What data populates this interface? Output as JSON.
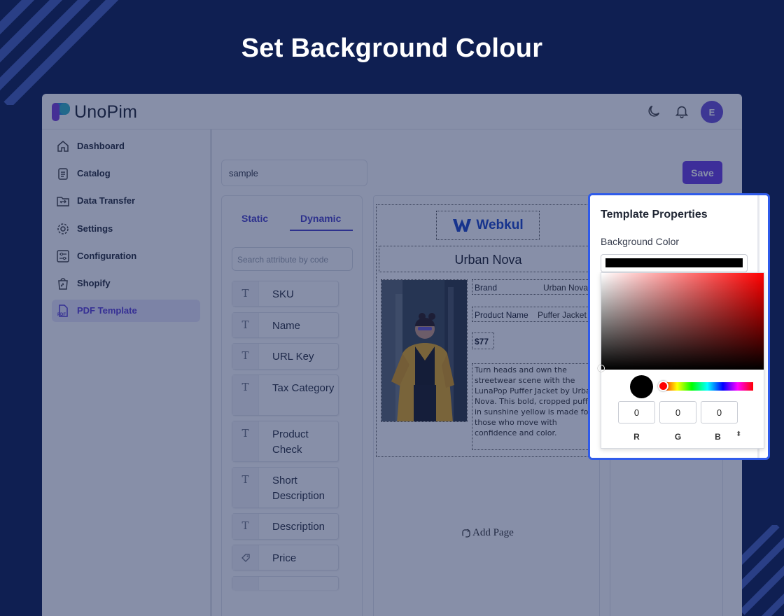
{
  "banner": {
    "title": "Set Background Colour"
  },
  "app": {
    "logo_text": "UnoPim",
    "user_initial": "E"
  },
  "sidebar": {
    "items": [
      {
        "label": "Dashboard",
        "icon": "home-icon"
      },
      {
        "label": "Catalog",
        "icon": "clipboard-icon"
      },
      {
        "label": "Data Transfer",
        "icon": "folder-transfer-icon"
      },
      {
        "label": "Settings",
        "icon": "gear-icon"
      },
      {
        "label": "Configuration",
        "icon": "sliders-icon"
      },
      {
        "label": "Shopify",
        "icon": "shopify-bag-icon"
      },
      {
        "label": "PDF Template",
        "icon": "pdf-icon",
        "active": true
      }
    ]
  },
  "editor": {
    "template_name": "sample",
    "save_label": "Save",
    "tabs": {
      "static": "Static",
      "dynamic": "Dynamic",
      "active": "Dynamic"
    },
    "attribute_search_placeholder": "Search attribute by code",
    "attributes": [
      {
        "label": "SKU",
        "icon": "T"
      },
      {
        "label": "Name",
        "icon": "T"
      },
      {
        "label": "URL Key",
        "icon": "T"
      },
      {
        "label": "Tax Category",
        "icon": "T"
      },
      {
        "label": "Product Check",
        "icon": "T"
      },
      {
        "label": "Short Description",
        "icon": "T"
      },
      {
        "label": "Description",
        "icon": "T"
      },
      {
        "label": "Price",
        "icon": "price-tag-icon"
      }
    ]
  },
  "canvas": {
    "logo_text": "Webkul",
    "brand_title": "Urban Nova",
    "fields": [
      {
        "key": "Brand",
        "value": "Urban Nova"
      },
      {
        "key": "Product Name",
        "value": "Puffer Jacket"
      }
    ],
    "price": "$77",
    "description": "Turn heads and own the streetwear scene with the LunaPop Puffer Jacket by Urban Nova. This bold, cropped puffer in sunshine yellow is made for those who move with confidence and color.",
    "add_page_label": "Add  Page"
  },
  "properties": {
    "title": "Template Properties",
    "background_label": "Background Color",
    "background_value": "#000000",
    "rgb": {
      "r": "0",
      "g": "0",
      "b": "0"
    },
    "rgb_labels": {
      "r": "R",
      "g": "G",
      "b": "B"
    },
    "hue_color": "#ff0000"
  },
  "colors": {
    "page_bg": "#0f1f52",
    "accent": "#6a3de3",
    "highlight_border": "#2f5bea"
  }
}
